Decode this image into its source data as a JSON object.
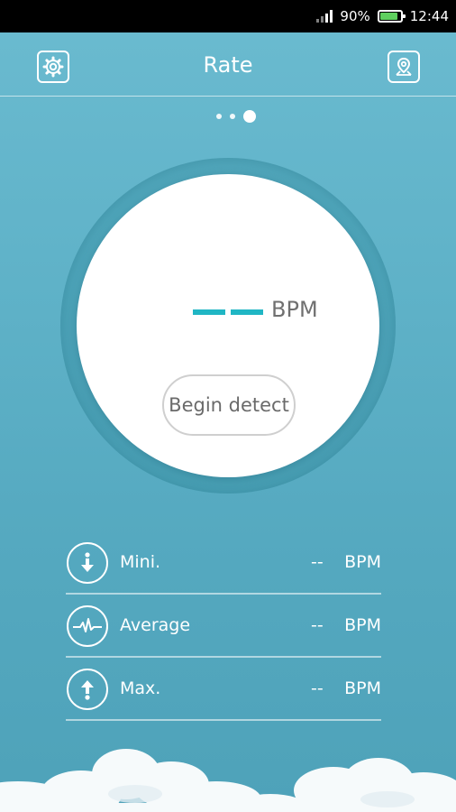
{
  "status_bar": {
    "battery_percent": "90%",
    "time": "12:44",
    "battery_level": 0.9
  },
  "header": {
    "title": "Rate",
    "left_icon": "gear-icon",
    "right_icon": "location-pin-icon"
  },
  "pager": {
    "count": 3,
    "active_index": 2
  },
  "reading": {
    "value": "——",
    "unit": "BPM",
    "detect_button_label": "Begin detect",
    "accent_color": "#20b6c4"
  },
  "stats": [
    {
      "label": "Mini.",
      "value": "--",
      "unit": "BPM",
      "icon": "arrow-down-icon"
    },
    {
      "label": "Average",
      "value": "--",
      "unit": "BPM",
      "icon": "heartbeat-icon"
    },
    {
      "label": "Max.",
      "value": "--",
      "unit": "BPM",
      "icon": "arrow-up-icon"
    }
  ]
}
